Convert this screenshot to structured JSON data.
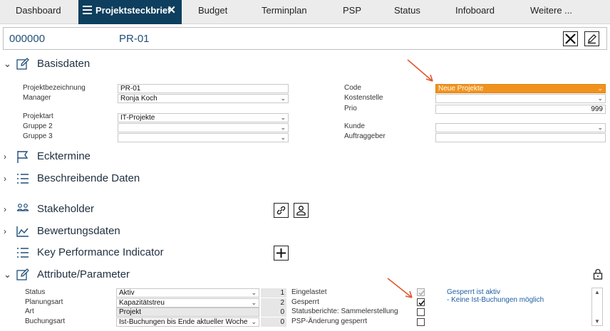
{
  "tabs": [
    {
      "label": "Dashboard"
    },
    {
      "label": "Projektsteckbrief"
    },
    {
      "label": "Budget"
    },
    {
      "label": "Terminplan"
    },
    {
      "label": "PSP"
    },
    {
      "label": "Status"
    },
    {
      "label": "Infoboard"
    },
    {
      "label": "Weitere ..."
    }
  ],
  "header": {
    "number": "000000",
    "code": "PR-01"
  },
  "sections": {
    "basisdaten": "Basisdaten",
    "ecktermine": "Ecktermine",
    "beschreibende": "Beschreibende Daten",
    "stakeholder": "Stakeholder",
    "bewertungsdaten": "Bewertungsdaten",
    "kpi": "Key Performance Indicator",
    "attribute": "Attribute/Parameter"
  },
  "basis": {
    "projektbezeichnung": {
      "label": "Projektbezeichnung",
      "value": "PR-01"
    },
    "manager": {
      "label": "Manager",
      "value": "Ronja Koch"
    },
    "projektart": {
      "label": "Projektart",
      "value": "IT-Projekte"
    },
    "gruppe2": {
      "label": "Gruppe 2",
      "value": ""
    },
    "gruppe3": {
      "label": "Gruppe 3",
      "value": ""
    },
    "code": {
      "label": "Code",
      "value": "Neue Projekte"
    },
    "kostenstelle": {
      "label": "Kostenstelle",
      "value": ""
    },
    "prio": {
      "label": "Prio",
      "value": "999"
    },
    "kunde": {
      "label": "Kunde",
      "value": ""
    },
    "auftraggeber": {
      "label": "Auftraggeber",
      "value": ""
    }
  },
  "attribute": {
    "rows": [
      {
        "label": "Status",
        "value": "Aktiv",
        "num": "1",
        "flag": "Eingelastet",
        "checked": true,
        "disabled": true
      },
      {
        "label": "Planungsart",
        "value": "Kapazitätstreu",
        "num": "2",
        "flag": "Gesperrt",
        "checked": true,
        "disabled": false
      },
      {
        "label": "Art",
        "value": "Projekt",
        "num": "0",
        "flag": "Statusberichte: Sammelerstellung",
        "checked": false,
        "disabled": false
      },
      {
        "label": "Buchungsart",
        "value": "Ist-Buchungen bis Ende aktueller Woche",
        "num": "0",
        "flag": "PSP-Änderung gesperrt",
        "checked": false,
        "disabled": false
      }
    ],
    "info_line1": "Gesperrt ist aktiv",
    "info_line2": "- Keine Ist-Buchungen möglich"
  },
  "colors": {
    "accent": "#0e3f5e",
    "highlight": "#f0931e",
    "arrow": "#e2572b",
    "link": "#1f5fa0"
  },
  "icons": [
    "menu-icon",
    "close-icon",
    "edit-icon",
    "flag-icon",
    "list-icon",
    "people-icon",
    "chart-icon",
    "link-icon",
    "person-icon",
    "plus-icon",
    "lock-icon"
  ]
}
